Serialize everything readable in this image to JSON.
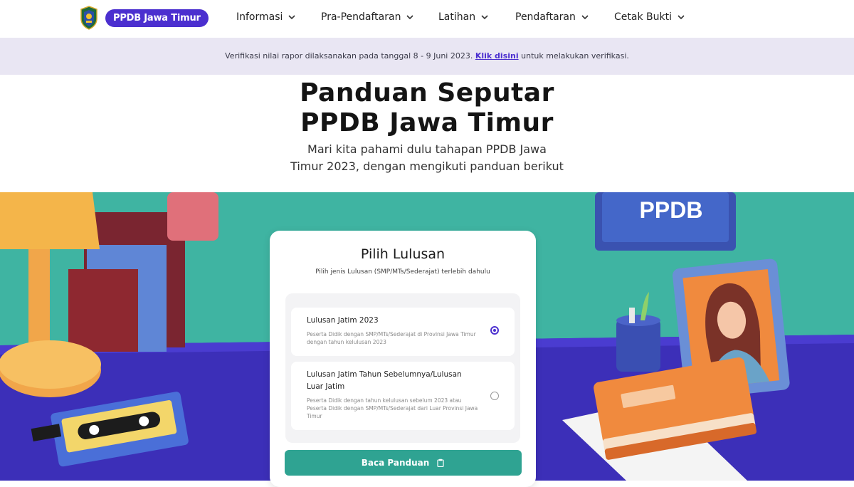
{
  "brand": {
    "name": "PPDB Jawa Timur",
    "logo_icon": "east-java-emblem-icon"
  },
  "nav": {
    "items": [
      {
        "label": "Informasi",
        "icon": "chevron-down-icon"
      },
      {
        "label": "Pra-Pendaftaran",
        "icon": "chevron-down-icon"
      },
      {
        "label": "Latihan",
        "icon": "chevron-down-icon"
      },
      {
        "label": "Pendaftaran",
        "icon": "chevron-down-icon"
      },
      {
        "label": "Cetak Bukti",
        "icon": "chevron-down-icon"
      }
    ]
  },
  "banner": {
    "text_before": "Verifikasi nilai rapor dilaksanakan pada tanggal 8 - 9 Juni 2023.",
    "link_text": "Klik disini",
    "text_after": "untuk melakukan verifikasi."
  },
  "hero": {
    "title_line1": "Panduan Seputar",
    "title_line2": "PPDB Jawa Timur",
    "subtitle_line1": "Mari kita pahami dulu tahapan PPDB Jawa",
    "subtitle_line2": "Timur 2023, dengan mengikuti panduan berikut"
  },
  "scene": {
    "sign_text": "PPDB"
  },
  "card": {
    "title": "Pilih Lulusan",
    "hint": "Pilih jenis Lulusan (SMP/MTs/Sederajat) terlebih dahulu",
    "options": [
      {
        "title": "Lulusan Jatim 2023",
        "description": "Peserta Didik dengan SMP/MTs/Sederajat di Provinsi Jawa Timur dengan tahun kelulusan 2023",
        "selected": true
      },
      {
        "title": "Lulusan Jatim Tahun Sebelumnya/Lulusan Luar Jatim",
        "description": "Peserta Didik dengan tahun kelulusan sebelum 2023 atau Peserta Didik dengan SMP/MTs/Sederajat dari Luar Provinsi Jawa Timur",
        "selected": false
      }
    ],
    "button_label": "Baca Panduan",
    "button_icon": "clipboard-icon"
  },
  "colors": {
    "brand_purple": "#4b2fcf",
    "teal_wall": "#3fb4a2",
    "desk_indigo": "#3c2fb8",
    "button_teal": "#2fa392"
  }
}
